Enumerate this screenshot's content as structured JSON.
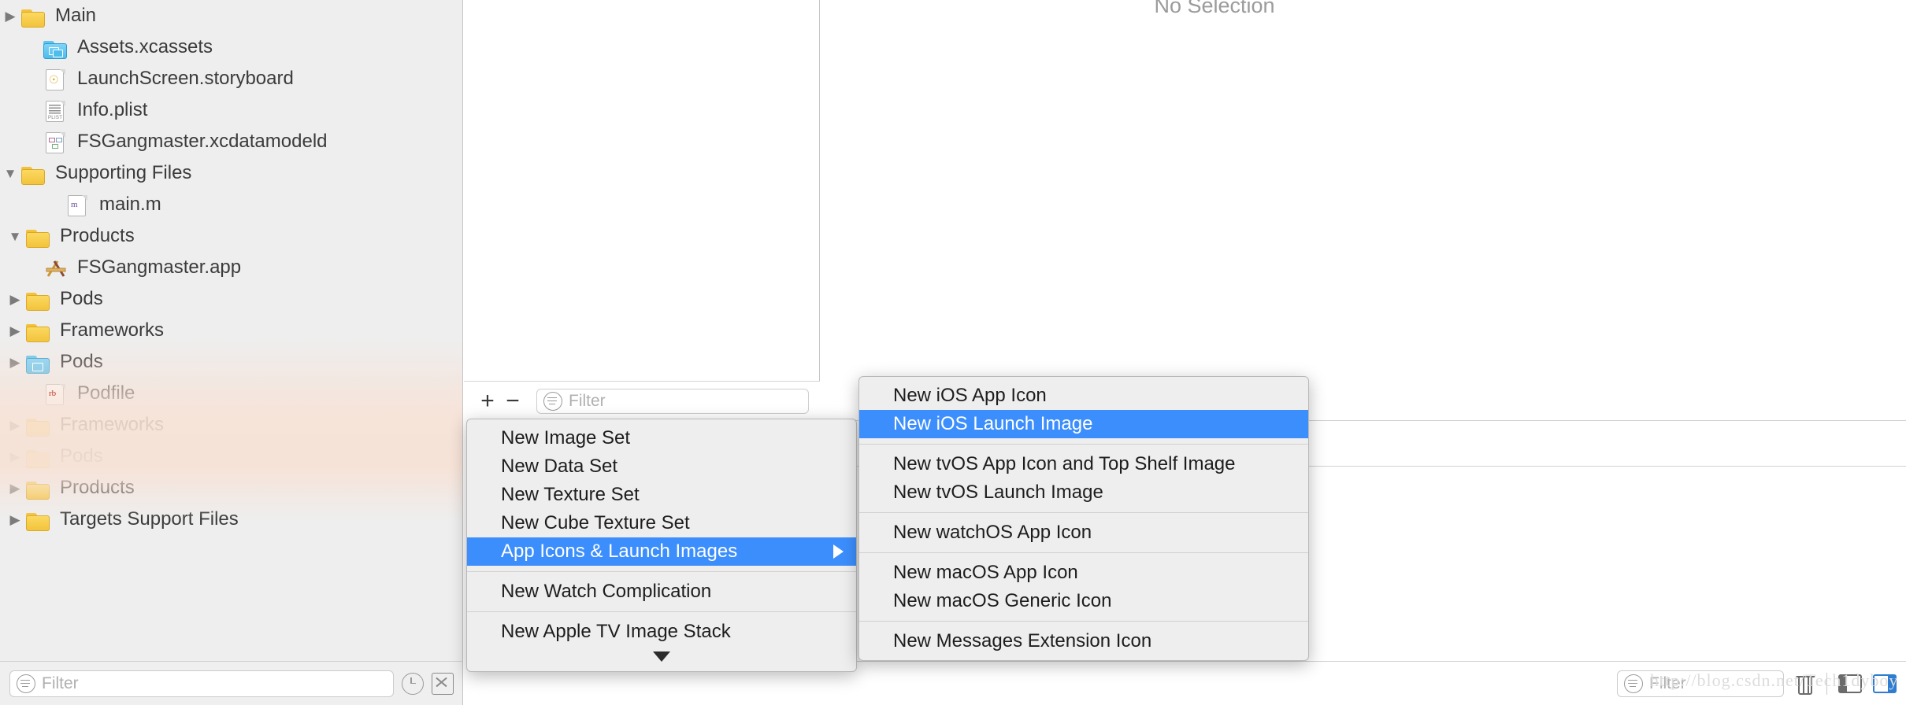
{
  "navigator": {
    "items": [
      {
        "label": "Main",
        "icon": "folder-icon",
        "twisty": "collapsed",
        "indent": 1
      },
      {
        "label": "Assets.xcassets",
        "icon": "xcassets-icon",
        "twisty": "none",
        "indent": 2
      },
      {
        "label": "LaunchScreen.storyboard",
        "icon": "storyboard-icon",
        "twisty": "none",
        "indent": 2
      },
      {
        "label": "Info.plist",
        "icon": "plist-icon",
        "twisty": "none",
        "indent": 2
      },
      {
        "label": "FSGangmaster.xcdatamodeld",
        "icon": "xcdatamodeld-icon",
        "twisty": "none",
        "indent": 2
      },
      {
        "label": "Supporting Files",
        "icon": "folder-icon",
        "twisty": "expanded",
        "indent": 1
      },
      {
        "label": "main.m",
        "icon": "objc-file-icon",
        "twisty": "none",
        "indent": 3
      },
      {
        "label": "Products",
        "icon": "folder-icon",
        "twisty": "expanded",
        "indent": 0
      },
      {
        "label": "FSGangmaster.app",
        "icon": "xcode-app-icon",
        "twisty": "none",
        "indent": 2
      },
      {
        "label": "Pods",
        "icon": "folder-icon",
        "twisty": "collapsed",
        "indent": 0
      },
      {
        "label": "Frameworks",
        "icon": "folder-icon",
        "twisty": "collapsed",
        "indent": 0
      },
      {
        "label": "Pods",
        "icon": "xcodeproj-icon",
        "twisty": "collapsed",
        "indent": 0
      },
      {
        "label": "Podfile",
        "icon": "ruby-file-icon",
        "twisty": "none",
        "indent": 2
      },
      {
        "label": "Frameworks",
        "icon": "folder-icon",
        "twisty": "collapsed",
        "indent": 0
      },
      {
        "label": "Pods",
        "icon": "folder-icon",
        "twisty": "collapsed",
        "indent": 0
      },
      {
        "label": "Products",
        "icon": "folder-icon",
        "twisty": "collapsed",
        "indent": 0
      },
      {
        "label": "Targets Support Files",
        "icon": "folder-icon",
        "twisty": "collapsed",
        "indent": 0
      }
    ],
    "filter": {
      "placeholder": "Filter",
      "value": "",
      "recents_icon": "clock-icon",
      "clear_icon": "x-box-icon",
      "filter_icon": "filter-icon"
    }
  },
  "asset_pane": {
    "toolbar": {
      "add_label": "+",
      "remove_label": "−",
      "filter_placeholder": "Filter",
      "filter_value": "",
      "filter_icon": "filter-icon"
    }
  },
  "detail": {
    "no_selection": "No Selection",
    "bottom": {
      "filter_placeholder": "Filter",
      "filter_value": "",
      "filter_icon": "filter-icon",
      "trash_icon": "trash-icon",
      "left_panel_icon": "panel-left-toggle-icon",
      "right_panel_icon": "panel-right-toggle-icon"
    }
  },
  "menus": {
    "main": {
      "groups": [
        {
          "items": [
            {
              "label": "New Image Set",
              "selected": false,
              "submenu": false
            },
            {
              "label": "New Data Set",
              "selected": false,
              "submenu": false
            },
            {
              "label": "New Texture Set",
              "selected": false,
              "submenu": false
            },
            {
              "label": "New Cube Texture Set",
              "selected": false,
              "submenu": false
            },
            {
              "label": "App Icons & Launch Images",
              "selected": true,
              "submenu": true
            }
          ]
        },
        {
          "items": [
            {
              "label": "New Watch Complication",
              "selected": false,
              "submenu": false
            }
          ]
        },
        {
          "items": [
            {
              "label": "New Apple TV Image Stack",
              "selected": false,
              "submenu": false
            }
          ]
        }
      ],
      "scroll_arrow_icon": "chevron-down-icon"
    },
    "submenu": {
      "groups": [
        {
          "items": [
            {
              "label": "New iOS App Icon",
              "selected": false
            },
            {
              "label": "New iOS Launch Image",
              "selected": true
            }
          ]
        },
        {
          "items": [
            {
              "label": "New tvOS App Icon and Top Shelf Image",
              "selected": false
            },
            {
              "label": "New tvOS Launch Image",
              "selected": false
            }
          ]
        },
        {
          "items": [
            {
              "label": "New watchOS App Icon",
              "selected": false
            }
          ]
        },
        {
          "items": [
            {
              "label": "New macOS App Icon",
              "selected": false
            },
            {
              "label": "New macOS Generic Icon",
              "selected": false
            }
          ]
        },
        {
          "items": [
            {
              "label": "New Messages Extension Icon",
              "selected": false
            }
          ]
        }
      ]
    }
  },
  "watermark": {
    "text": "http://blog.csdn.net/Tech1dyboy"
  },
  "colors": {
    "selection_blue": "#3c8efc",
    "folder_yellow": "#f3c33c",
    "xcassets_blue": "#4fbdec",
    "menu_background": "#eeeeee",
    "navigator_background": "#eeeeee"
  }
}
